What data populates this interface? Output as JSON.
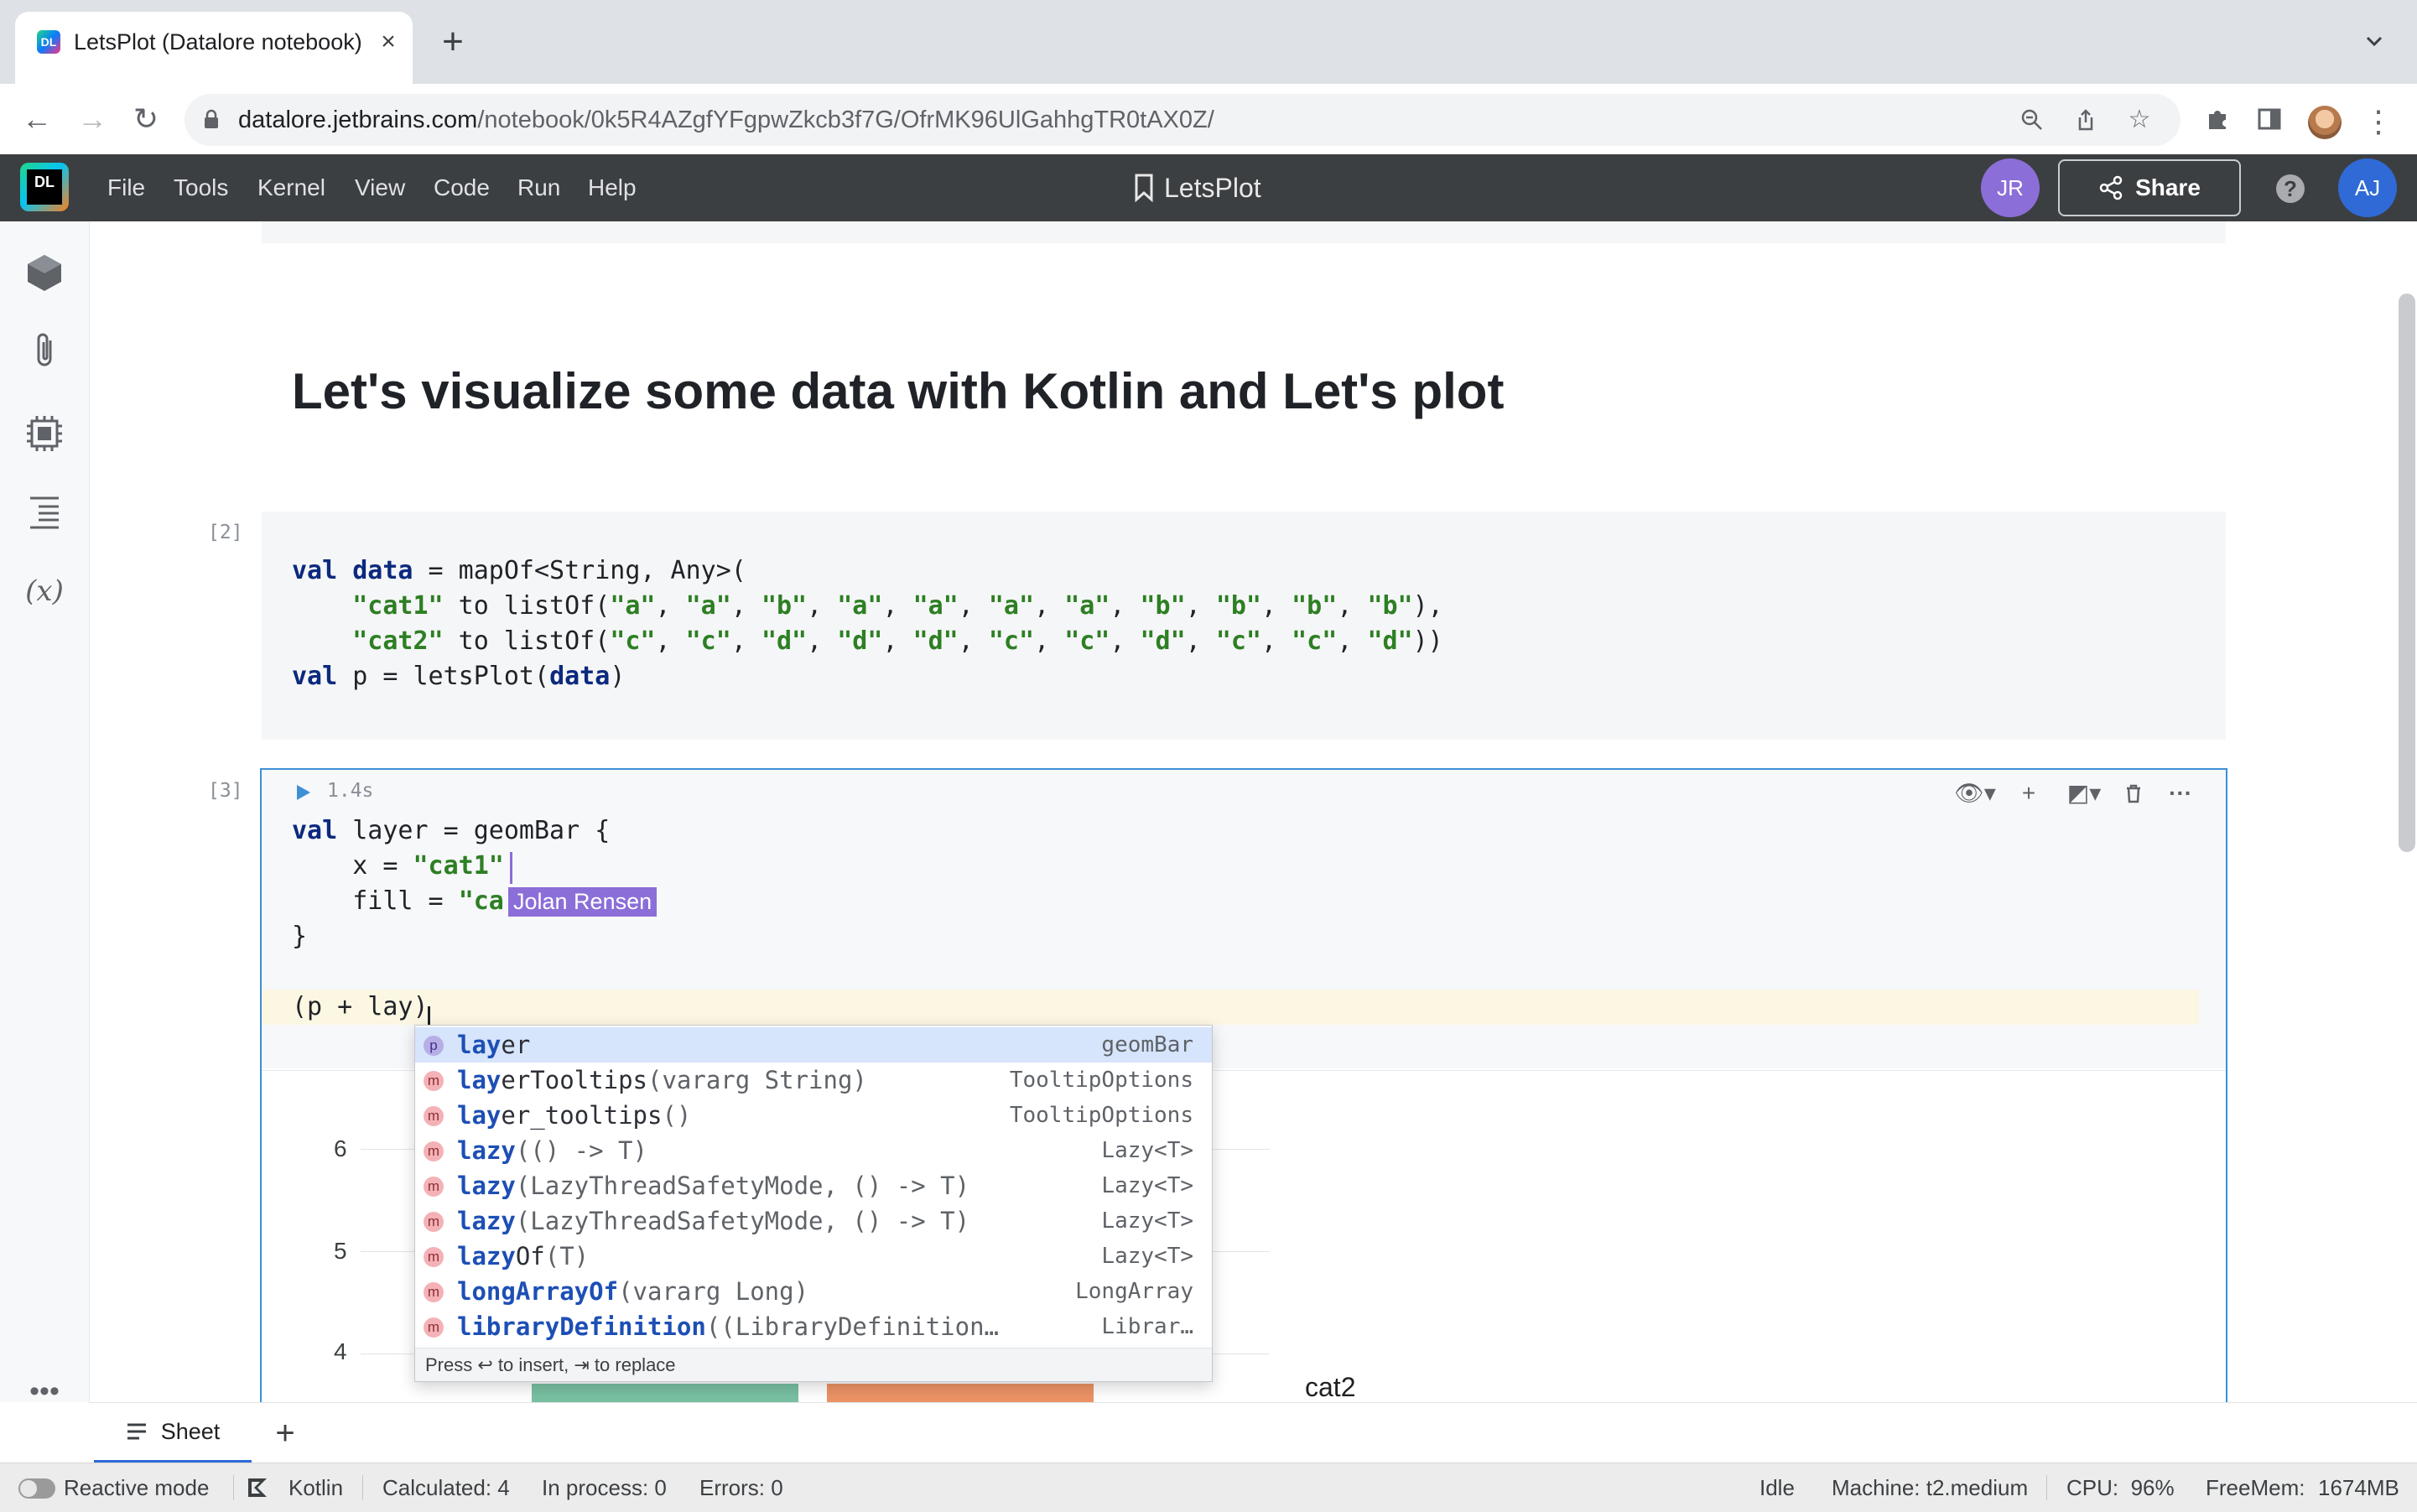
{
  "browser": {
    "tab_title": "LetsPlot (Datalore notebook)",
    "favicon_text": "DL",
    "url_host": "datalore.jetbrains.com",
    "url_path": "/notebook/0k5R4AZgfYFgpwZkcb3f7G/OfrMK96UlGahhgTR0tAX0Z/"
  },
  "app": {
    "logo_text": "DL",
    "menu": [
      "File",
      "Tools",
      "Kernel",
      "View",
      "Code",
      "Run",
      "Help"
    ],
    "notebook_title": "LetsPlot",
    "collaborator_initials": "JR",
    "share_label": "Share",
    "help_label": "?",
    "user_initials": "AJ",
    "accent": "#2f6ad6"
  },
  "notebook": {
    "heading": "Let's visualize some data with Kotlin and Let's plot",
    "cell2": {
      "exec_count": "[2]",
      "lines": [
        [
          [
            "kw",
            "val "
          ],
          [
            "kw",
            "data"
          ],
          [
            "t",
            " = mapOf<String, Any>("
          ]
        ],
        [
          [
            "t",
            "    "
          ],
          [
            "str",
            "\"cat1\""
          ],
          [
            "t",
            " to listOf("
          ],
          [
            "str",
            "\"a\""
          ],
          [
            "t",
            ", "
          ],
          [
            "str",
            "\"a\""
          ],
          [
            "t",
            ", "
          ],
          [
            "str",
            "\"b\""
          ],
          [
            "t",
            ", "
          ],
          [
            "str",
            "\"a\""
          ],
          [
            "t",
            ", "
          ],
          [
            "str",
            "\"a\""
          ],
          [
            "t",
            ", "
          ],
          [
            "str",
            "\"a\""
          ],
          [
            "t",
            ", "
          ],
          [
            "str",
            "\"a\""
          ],
          [
            "t",
            ", "
          ],
          [
            "str",
            "\"b\""
          ],
          [
            "t",
            ", "
          ],
          [
            "str",
            "\"b\""
          ],
          [
            "t",
            ", "
          ],
          [
            "str",
            "\"b\""
          ],
          [
            "t",
            ", "
          ],
          [
            "str",
            "\"b\""
          ],
          [
            "t",
            "),"
          ]
        ],
        [
          [
            "t",
            "    "
          ],
          [
            "str",
            "\"cat2\""
          ],
          [
            "t",
            " to listOf("
          ],
          [
            "str",
            "\"c\""
          ],
          [
            "t",
            ", "
          ],
          [
            "str",
            "\"c\""
          ],
          [
            "t",
            ", "
          ],
          [
            "str",
            "\"d\""
          ],
          [
            "t",
            ", "
          ],
          [
            "str",
            "\"d\""
          ],
          [
            "t",
            ", "
          ],
          [
            "str",
            "\"d\""
          ],
          [
            "t",
            ", "
          ],
          [
            "str",
            "\"c\""
          ],
          [
            "t",
            ", "
          ],
          [
            "str",
            "\"c\""
          ],
          [
            "t",
            ", "
          ],
          [
            "str",
            "\"d\""
          ],
          [
            "t",
            ", "
          ],
          [
            "str",
            "\"c\""
          ],
          [
            "t",
            ", "
          ],
          [
            "str",
            "\"c\""
          ],
          [
            "t",
            ", "
          ],
          [
            "str",
            "\"d\""
          ],
          [
            "t",
            "))"
          ]
        ],
        [
          [
            "kw",
            "val "
          ],
          [
            "t",
            "p = letsPlot("
          ],
          [
            "kw",
            "data"
          ],
          [
            "t",
            ")"
          ]
        ]
      ]
    },
    "cell3": {
      "exec_count": "[3]",
      "exec_time": "1.4s",
      "lines": [
        [
          [
            "kw",
            "val "
          ],
          [
            "t",
            "layer = geomBar {"
          ]
        ],
        [
          [
            "t",
            "    x = "
          ],
          [
            "str",
            "\"cat1\""
          ]
        ],
        [
          [
            "t",
            "    fill = "
          ],
          [
            "str",
            "\"ca"
          ]
        ],
        [
          [
            "t",
            "}"
          ]
        ],
        [
          [
            "t",
            ""
          ]
        ],
        [
          [
            "t",
            "(p + lay)"
          ]
        ]
      ],
      "collaborator_cursor_label": "Jolan Rensen",
      "collaborator_color": "#8b6ed8"
    },
    "chart_partial": {
      "y_ticks": [
        "6",
        "5",
        "4"
      ],
      "legend_title": "cat2",
      "bar_colors": [
        "#79c0a2",
        "#ec9365"
      ]
    }
  },
  "autocomplete": {
    "items": [
      {
        "kind": "p",
        "match": "lay",
        "rest": "er",
        "sig": "",
        "type": "geomBar",
        "selected": true
      },
      {
        "kind": "m",
        "match": "lay",
        "rest": "erTooltips",
        "sig": "(vararg String)",
        "type": "TooltipOptions",
        "selected": false
      },
      {
        "kind": "m",
        "match": "lay",
        "rest": "er_tooltips",
        "sig": "()",
        "type": "TooltipOptions",
        "selected": false
      },
      {
        "kind": "m",
        "match": "lazy",
        "rest": "",
        "sig": "(() -> T)",
        "type": "Lazy<T>",
        "selected": false
      },
      {
        "kind": "m",
        "match": "lazy",
        "rest": "",
        "sig": "(LazyThreadSafetyMode, () -> T)",
        "type": "Lazy<T>",
        "selected": false
      },
      {
        "kind": "m",
        "match": "lazy",
        "rest": "",
        "sig": "(LazyThreadSafetyMode, () -> T)",
        "type": "Lazy<T>",
        "selected": false
      },
      {
        "kind": "m",
        "match": "lazy",
        "rest": "Of",
        "sig": "(T)",
        "type": "Lazy<T>",
        "selected": false
      },
      {
        "kind": "m",
        "match": "longArrayOf",
        "rest": "",
        "sig": "(vararg Long)",
        "type": "LongArray",
        "selected": false
      },
      {
        "kind": "m",
        "match": "libraryDefinition",
        "rest": "",
        "sig": "((LibraryDefinition…",
        "type": "Librar…",
        "selected": false
      }
    ],
    "hint": "Press ↩ to insert, ⇥ to replace"
  },
  "sheets": {
    "tabs": [
      "Sheet"
    ],
    "add_label": "+"
  },
  "status": {
    "reactive_mode": "Reactive mode",
    "language": "Kotlin",
    "calculated": "Calculated: 4",
    "in_process": "In process: 0",
    "errors": "Errors: 0",
    "kernel_state": "Idle",
    "machine": "Machine: t2.medium",
    "cpu": "CPU:  96%",
    "freemem": "FreeMem:",
    "freemem_value": "1674MB"
  }
}
